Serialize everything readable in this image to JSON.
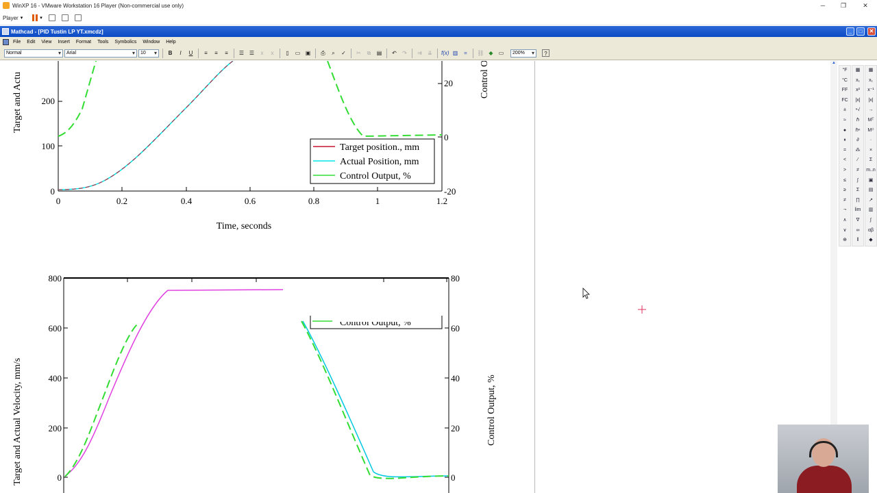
{
  "vm": {
    "title": "WinXP 16 - VMware Workstation 16 Player (Non-commercial use only)",
    "player_menu": "Player"
  },
  "mathcad": {
    "title": "Mathcad - [PID Tustin LP YT.xmcdz]",
    "menu": [
      "File",
      "Edit",
      "View",
      "Insert",
      "Format",
      "Tools",
      "Symbolics",
      "Window",
      "Help"
    ],
    "style_value": "Normal",
    "font_value": "Arial",
    "size_value": "10",
    "zoom_value": "200%",
    "format_buttons": [
      "B",
      "I",
      "U"
    ]
  },
  "plot1": {
    "ylabel": "Target and Actu",
    "y2label": "Control O",
    "xlabel": "Time, seconds",
    "yticks": [
      "200",
      "100",
      "0"
    ],
    "y2ticks": [
      "20",
      "0",
      "-20"
    ],
    "xticks": [
      "0",
      "0.2",
      "0.4",
      "0.6",
      "0.8",
      "1",
      "1.2"
    ],
    "legend": [
      "Target position., mm",
      "Actual Position, mm",
      "Control Output, %"
    ]
  },
  "plot2": {
    "ylabel": "Target and Actual Velocity, mm/s",
    "y2label": "Control Output, %",
    "yticks": [
      "800",
      "600",
      "400",
      "200",
      "0"
    ],
    "y2ticks": [
      "80",
      "60",
      "40",
      "20",
      "0"
    ],
    "legend_partial": "Control Output, %"
  },
  "colors": {
    "target": "#c8102e",
    "actual": "#00e5e5",
    "control": "#33dd33",
    "velocity_target": "#e040e0"
  },
  "palette_left": [
    "°F",
    "°C",
    "FF",
    "FC",
    "±",
    "≈",
    "●",
    "⏸",
    "=",
    "<",
    ">",
    "≤",
    "≥",
    "≠",
    "¬",
    "∧",
    "∨",
    "⊕"
  ],
  "palette_right": [
    "▦",
    "x₁",
    "x²",
    "|x|",
    "ⁿ√",
    "ℏ",
    "ℏⁿ",
    "∂",
    "⁂",
    "⁄",
    "≠",
    "∫",
    "Σ",
    "∏",
    "lim",
    "∇",
    "∞",
    "‖"
  ]
}
